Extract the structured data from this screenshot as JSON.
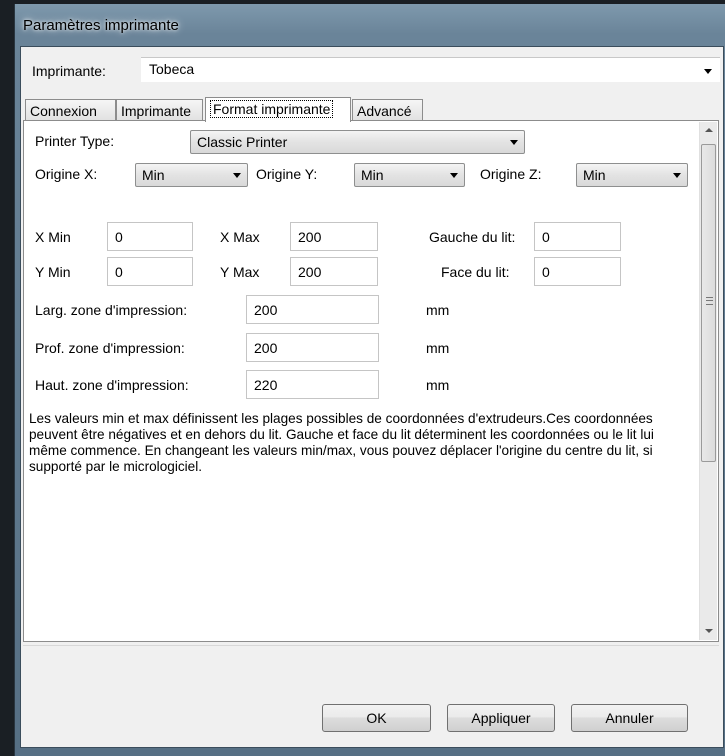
{
  "window": {
    "title": "Paramètres imprimante"
  },
  "printer": {
    "label": "Imprimante:",
    "value": "Tobeca"
  },
  "tabs": [
    {
      "label": "Connexion",
      "active": false
    },
    {
      "label": "Imprimante",
      "active": false
    },
    {
      "label": "Format imprimante",
      "active": true
    },
    {
      "label": "Advancé",
      "active": false
    }
  ],
  "printer_type": {
    "label": "Printer Type:",
    "value": "Classic Printer"
  },
  "origin": {
    "x": {
      "label": "Origine X:",
      "value": "Min"
    },
    "y": {
      "label": "Origine Y:",
      "value": "Min"
    },
    "z": {
      "label": "Origine Z:",
      "value": "Min"
    }
  },
  "bounds": {
    "x_min": {
      "label": "X Min",
      "value": "0"
    },
    "x_max": {
      "label": "X Max",
      "value": "200"
    },
    "bed_left": {
      "label": "Gauche du lit:",
      "value": "0"
    },
    "y_min": {
      "label": "Y Min",
      "value": "0"
    },
    "y_max": {
      "label": "Y Max",
      "value": "200"
    },
    "bed_front": {
      "label": "Face du lit:",
      "value": "0"
    }
  },
  "dimensions": {
    "width": {
      "label": "Larg. zone d'impression:",
      "value": "200",
      "unit": "mm"
    },
    "depth": {
      "label": "Prof. zone d'impression:",
      "value": "200",
      "unit": "mm"
    },
    "height": {
      "label": "Haut. zone d'impression:",
      "value": "220",
      "unit": "mm"
    }
  },
  "description": "Les valeurs min et max définissent les plages possibles de coordonnées d'extrudeurs.Ces coordonnées peuvent être négatives et en dehors du lit. Gauche et face du lit déterminent les coordonnées ou le lit lui même commence. En changeant les valeurs min/max, vous pouvez déplacer l'origine du centre du lit, si supporté par le micrologiciel.",
  "buttons": {
    "ok": "OK",
    "apply": "Appliquer",
    "cancel": "Annuler"
  }
}
